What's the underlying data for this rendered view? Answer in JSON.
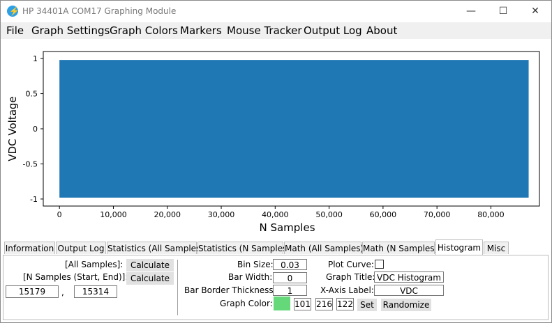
{
  "window": {
    "title": "HP 34401A COM17 Graphing Module",
    "controls": {
      "minimize": "—",
      "maximize": "☐",
      "close": "✕"
    }
  },
  "menu": [
    "File",
    "Graph Settings",
    "Graph Colors",
    "Markers",
    "Mouse Tracker",
    "Output Log",
    "About"
  ],
  "chart_data": {
    "type": "line",
    "xlabel": "N Samples",
    "ylabel": "VDC Voltage",
    "xlim": [
      -3000,
      89000
    ],
    "ylim": [
      -1.1,
      1.1
    ],
    "x_ticks": [
      0,
      10000,
      20000,
      30000,
      40000,
      50000,
      60000,
      70000,
      80000
    ],
    "x_tick_labels": [
      "0",
      "10,000",
      "20,000",
      "30,000",
      "40,000",
      "50,000",
      "60,000",
      "70,000",
      "80,000"
    ],
    "y_ticks": [
      1,
      0.5,
      0,
      -0.5,
      -1
    ],
    "y_tick_labels": [
      "1",
      "0.5",
      "0",
      "-0.5",
      "-1"
    ],
    "series": [
      {
        "x_range": [
          0,
          87000
        ],
        "y_min": -0.98,
        "y_max": 0.98,
        "color": "#1f77b4"
      }
    ],
    "grid": false
  },
  "tabs": [
    {
      "label": "Information",
      "active": false
    },
    {
      "label": "Output Log",
      "active": false
    },
    {
      "label": "Statistics (All Samples)",
      "active": false
    },
    {
      "label": "Statistics (N Samples)",
      "active": false
    },
    {
      "label": "Math (All Samples)",
      "active": false
    },
    {
      "label": "Math (N Samples)",
      "active": false
    },
    {
      "label": "Histogram",
      "active": true
    },
    {
      "label": "Misc",
      "active": false
    }
  ],
  "histogram": {
    "all_samples_label": "[All Samples]:",
    "n_samples_label": "[N Samples (Start, End)]:",
    "calculate_label": "Calculate",
    "start_value": "15179",
    "comma": ",",
    "end_value": "15314",
    "bin_size_label": "Bin Size:",
    "bin_size": "0.03",
    "bar_width_label": "Bar Width:",
    "bar_width": "0",
    "bar_border_label": "Bar Border Thickness:",
    "bar_border": "1",
    "graph_color_label": "Graph Color:",
    "color_r": "101",
    "color_g": "216",
    "color_b": "122",
    "color_hex": "#65d87a",
    "set_label": "Set",
    "randomize_label": "Randomize",
    "plot_curve_label": "Plot Curve:",
    "plot_curve_checked": false,
    "graph_title_label": "Graph Title:",
    "graph_title": "VDC Histogram",
    "x_axis_label_label": "X-Axis Label:",
    "x_axis_label": "VDC"
  }
}
